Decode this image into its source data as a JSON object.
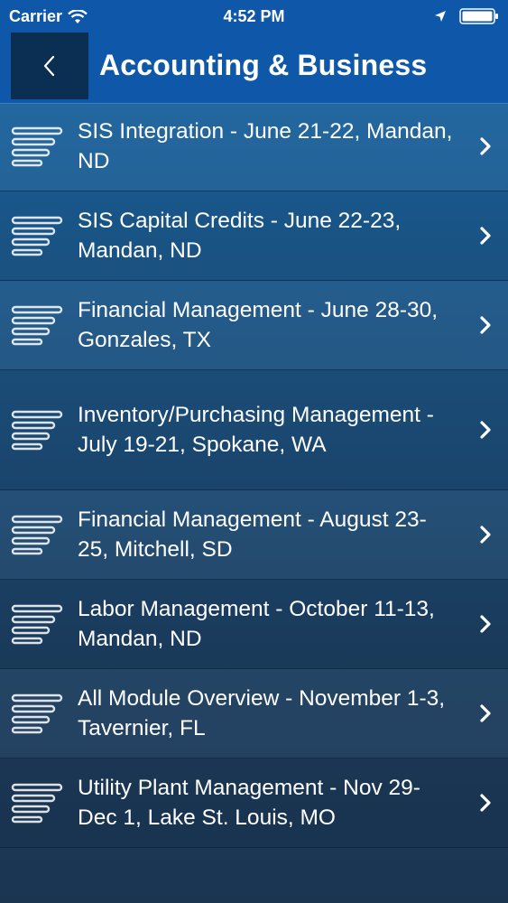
{
  "status_bar": {
    "carrier": "Carrier",
    "time": "4:52 PM"
  },
  "nav": {
    "title": "Accounting & Business"
  },
  "items": [
    {
      "label": "SIS Integration - June 21-22, Mandan, ND"
    },
    {
      "label": "SIS Capital Credits - June 22-23, Mandan, ND"
    },
    {
      "label": "Financial Management - June 28-30, Gonzales, TX"
    },
    {
      "label": "Inventory/Purchasing Management - July 19-21, Spokane, WA"
    },
    {
      "label": "Financial Management - August 23-25, Mitchell, SD"
    },
    {
      "label": "Labor Management - October 11-13, Mandan, ND"
    },
    {
      "label": "All Module Overview - November 1-3, Tavernier, FL"
    },
    {
      "label": "Utility Plant Management - Nov 29-Dec 1, Lake St. Louis, MO"
    }
  ],
  "icons": {
    "row_icon": "lines-icon",
    "row_chevron": "chevron-right-icon",
    "back": "back-chevron-icon"
  },
  "colors": {
    "nav_bar": "#0f57a8",
    "back_button": "#0b2f52"
  }
}
